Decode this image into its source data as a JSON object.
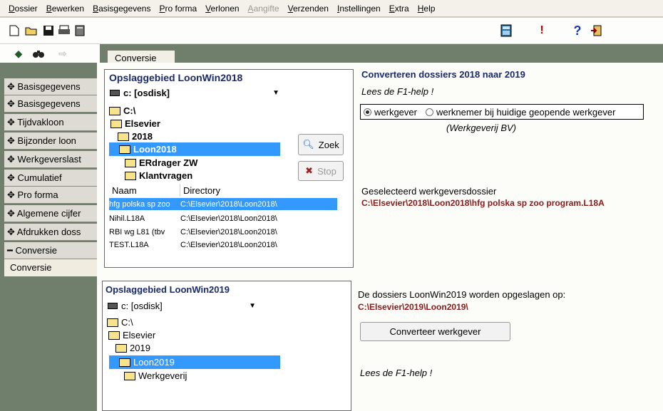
{
  "menu": [
    "Dossier",
    "Bewerken",
    "Basisgegevens",
    "Pro forma",
    "Verlonen",
    "Aangifte",
    "Verzenden",
    "Instellingen",
    "Extra",
    "Help"
  ],
  "menu_disabled": "Aangifte",
  "tab": {
    "label": "Conversie"
  },
  "left_nav": {
    "items": [
      "Basisgegevens",
      "Basisgegevens",
      "Tijdvakloon",
      "Bijzonder loon",
      "Werkgeverslast",
      "Cumulatief",
      "Pro forma",
      "Algemene cijfer",
      "Afdrukken doss",
      "Conversie"
    ],
    "sub_item": "Conversie"
  },
  "source": {
    "title": "Opslaggebied LoonWin2018",
    "drive": "c: [osdisk]",
    "tree": [
      "C:\\",
      "Elsevier",
      "2018",
      "Loon2018",
      "ERdrager ZW",
      "Klantvragen"
    ],
    "search_button": "Zoek",
    "stop_button": "Stop",
    "columns": [
      "Naam",
      "Directory"
    ],
    "files": [
      {
        "name": "hfg polska sp zoo",
        "dir": "C:\\Elsevier\\2018\\Loon2018\\"
      },
      {
        "name": "Nihil.L18A",
        "dir": "C:\\Elsevier\\2018\\Loon2018\\"
      },
      {
        "name": "RBI wg L81 (tbv",
        "dir": "C:\\Elsevier\\2018\\Loon2018\\"
      },
      {
        "name": "TEST.L18A",
        "dir": "C:\\Elsevier\\2018\\Loon2018\\"
      }
    ]
  },
  "target": {
    "title": "Opslaggebied LoonWin2019",
    "drive": "c: [osdisk]",
    "tree": [
      "C:\\",
      "Elsevier",
      "2019",
      "Loon2019",
      "Werkgeverij"
    ]
  },
  "right": {
    "heading": "Converteren dossiers 2018 naar 2019",
    "help1": "Lees de F1-help !",
    "radio_employer": "werkgever",
    "radio_employee": "werknemer bij huidige geopende werkgever",
    "employer_name": "(Werkgeverij BV)",
    "selected_label": "Geselecteerd werkgeversdossier",
    "selected_path": "C:\\Elsevier\\2018\\Loon2018\\hfg polska sp zoo program.L18A",
    "save_label": "De dossiers LoonWin2019 worden opgeslagen op:",
    "save_path": "C:\\Elsevier\\2019\\Loon2019\\",
    "convert_button": "Converteer werkgever",
    "help2": "Lees de F1-help !"
  }
}
